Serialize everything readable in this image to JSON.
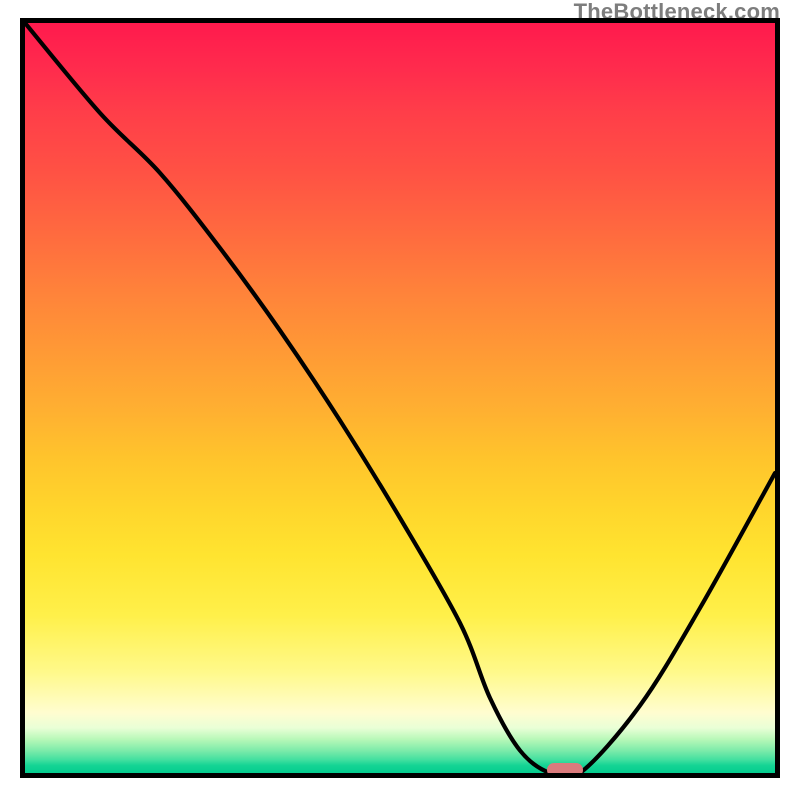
{
  "watermark": "TheBottleneck.com",
  "chart_data": {
    "type": "line",
    "title": "",
    "xlabel": "",
    "ylabel": "",
    "xlim": [
      0,
      100
    ],
    "ylim": [
      0,
      100
    ],
    "series": [
      {
        "name": "bottleneck-curve",
        "x": [
          0,
          10,
          18,
          26,
          34,
          42,
          50,
          58,
          62,
          66,
          70,
          74,
          82,
          90,
          100
        ],
        "values": [
          100,
          88,
          80,
          70,
          59,
          47,
          34,
          20,
          10,
          3,
          0,
          0,
          9,
          22,
          40
        ]
      }
    ],
    "marker": {
      "x": 72,
      "y": 0,
      "color": "#db7b7d"
    },
    "gradient_stops": [
      {
        "pos": 0.0,
        "color": "#ff1a4d"
      },
      {
        "pos": 0.2,
        "color": "#ff5244"
      },
      {
        "pos": 0.45,
        "color": "#ff9a35"
      },
      {
        "pos": 0.7,
        "color": "#ffe430"
      },
      {
        "pos": 0.92,
        "color": "#fffdd0"
      },
      {
        "pos": 1.0,
        "color": "#05cd8f"
      }
    ]
  }
}
